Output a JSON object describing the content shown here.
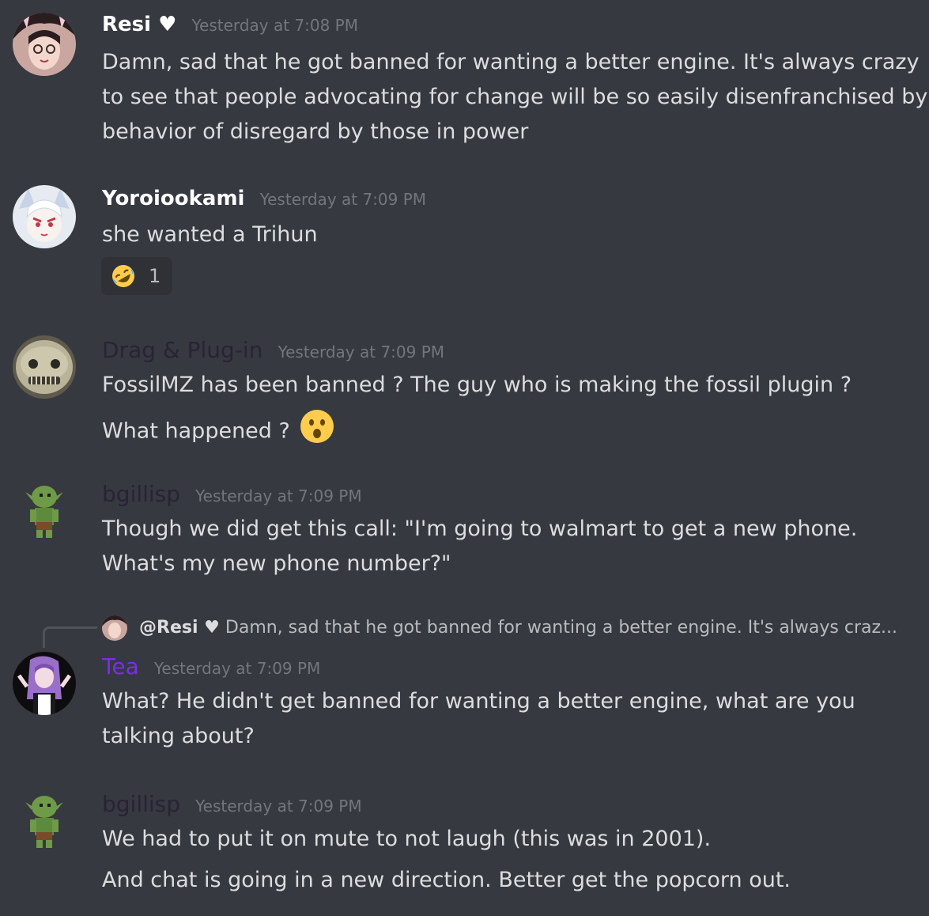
{
  "messages": [
    {
      "username": "Resi ♥",
      "username_color": "#ffffff",
      "timestamp": "Yesterday at 7:08 PM",
      "lines": [
        "Damn, sad that he got banned for wanting a better engine. It's always crazy",
        "to see that people advocating for change will be so easily disenfranchised by",
        "behavior of disregard by those in power"
      ]
    },
    {
      "username": "Yoroiookami",
      "username_color": "#ffffff",
      "timestamp": "Yesterday at 7:09 PM",
      "lines": [
        "she wanted a Trihun"
      ],
      "reaction": {
        "emoji": "rofl-emoji",
        "count": "1"
      }
    },
    {
      "username": "Drag & Plug-in",
      "username_color": "#2a2236",
      "timestamp": "Yesterday at 7:09 PM",
      "lines": [
        "FossilMZ has been banned ? The guy who is making the fossil plugin ?",
        "What happened ?"
      ],
      "inline_emoji": "open-mouth-emoji"
    },
    {
      "username": "bgillisp",
      "username_color": "#2a2236",
      "timestamp": "Yesterday at 7:09 PM",
      "lines": [
        "Though we did get this call: \"I'm going to walmart to get a new phone.",
        "What's my new phone number?\""
      ]
    },
    {
      "reply_to": {
        "username": "@Resi ♥",
        "preview": "Damn, sad that he got banned for wanting a better engine. It's always craz..."
      },
      "username": "Tea",
      "username_color": "#7b2cf0",
      "timestamp": "Yesterday at 7:09 PM",
      "lines": [
        "What? He didn't get banned for wanting a better engine, what are you",
        "talking about?"
      ]
    },
    {
      "username": "bgillisp",
      "username_color": "#2a2236",
      "timestamp": "Yesterday at 7:09 PM",
      "lines": [
        "We had to put it on mute to not laugh (this was in 2001).",
        "And chat is going in a new direction. Better get the popcorn out."
      ]
    }
  ]
}
